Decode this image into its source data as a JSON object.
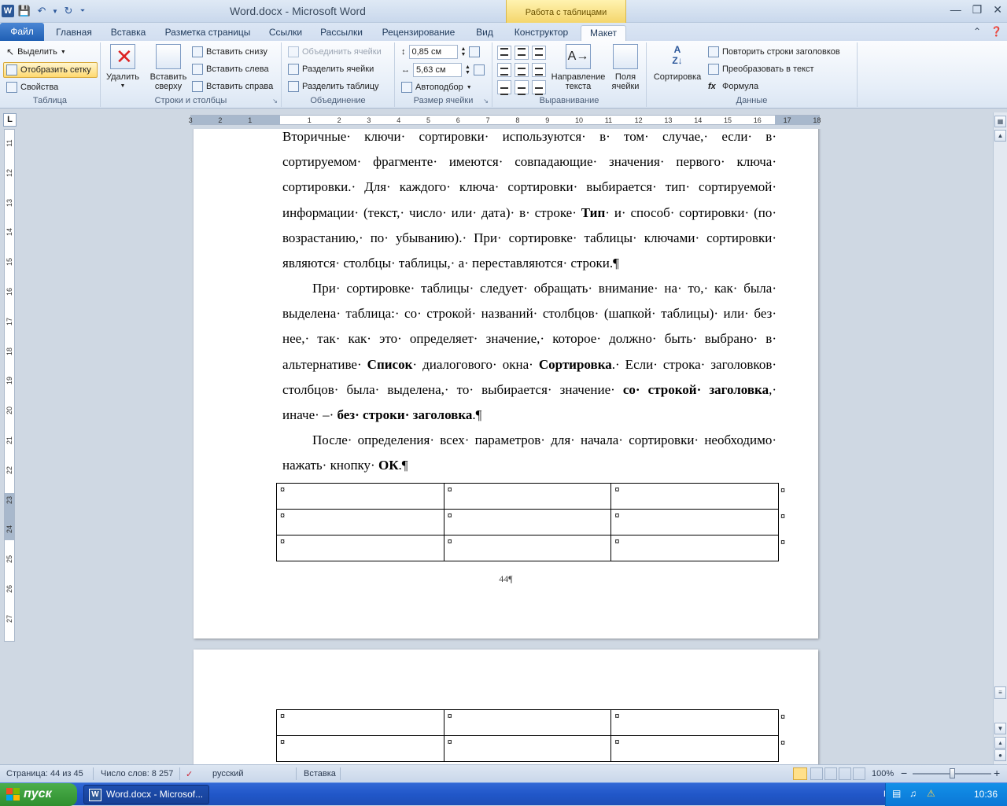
{
  "titlebar": {
    "title": "Word.docx  -  Microsoft Word",
    "context_label": "Работа с таблицами",
    "word_logo": "W"
  },
  "tabs": [
    "Файл",
    "Главная",
    "Вставка",
    "Разметка страницы",
    "Ссылки",
    "Рассылки",
    "Рецензирование",
    "Вид",
    "Конструктор",
    "Макет"
  ],
  "ribbon": {
    "table": {
      "label": "Таблица",
      "select": "Выделить",
      "show_grid": "Отобразить сетку",
      "properties": "Свойства"
    },
    "rows_cols": {
      "label": "Строки и столбцы",
      "delete": "Удалить",
      "insert_above_1": "Вставить",
      "insert_above_2": "сверху",
      "insert_below": "Вставить снизу",
      "insert_left": "Вставить слева",
      "insert_right": "Вставить справа"
    },
    "merge": {
      "label": "Объединение",
      "merge_cells": "Объединить ячейки",
      "split_cells": "Разделить ячейки",
      "split_table": "Разделить таблицу"
    },
    "cell_size": {
      "label": "Размер ячейки",
      "height": "0,85 см",
      "width": "5,63 см",
      "autofit": "Автоподбор"
    },
    "alignment": {
      "label": "Выравнивание",
      "direction_1": "Направление",
      "direction_2": "текста",
      "margins_1": "Поля",
      "margins_2": "ячейки"
    },
    "data": {
      "label": "Данные",
      "sort": "Сортировка",
      "repeat_header": "Повторить строки заголовков",
      "convert": "Преобразовать в текст",
      "formula": "Формула"
    }
  },
  "ruler": {
    "corner": "L",
    "h_ticks": [
      "3",
      "2",
      "1",
      "1",
      "2",
      "3",
      "4",
      "5",
      "6",
      "7",
      "8",
      "9",
      "10",
      "11",
      "12",
      "13",
      "14",
      "15",
      "16",
      "17",
      "18"
    ],
    "v_ticks": [
      "11",
      "12",
      "13",
      "14",
      "15",
      "16",
      "17",
      "18",
      "19",
      "20",
      "21",
      "22",
      "23",
      "24",
      "25",
      "26",
      "27"
    ]
  },
  "document": {
    "para1": [
      {
        "t": "Вторичные· ключи· сортировки· используются· в· том· случае,· если· в· сортируемом· фрагменте· имеются· совпадающие· значения· первого· ключа· сортировки.· Для· каждого· ключа· сортировки· выбирается· тип· сортируемой· информации· (текст,· число· или· дата)· в· строке· "
      },
      {
        "b": "Тип"
      },
      {
        "t": "· и· способ· сортировки· (по· возрастанию,· по· убыванию).· При· сортировке· таблицы· ключами· сортировки· являются· столбцы· таблицы,· а· переставляются· строки.¶"
      }
    ],
    "para2": [
      {
        "t": "При· сортировке· таблицы· следует· обращать· внимание· на· то,· как· была· выделена· таблица:· со· строкой· названий· столбцов· (шапкой· таблицы)· или· без· нее,· так· как· это· определяет· значение,· которое· должно· быть· выбрано· в· альтернативе· "
      },
      {
        "b": "Список"
      },
      {
        "t": "· диалогового· окна· "
      },
      {
        "b": "Сортировка"
      },
      {
        "t": ".· Если· строка· заголовков· столбцов· была· выделена,· то· выбирается· значение· "
      },
      {
        "b": "со· строкой· заголовка"
      },
      {
        "t": ",· иначе· –· "
      },
      {
        "b": "без· строки· заголовка"
      },
      {
        "t": ".¶"
      }
    ],
    "para3": [
      {
        "t": "После· определения· всех· параметров· для· начала· сортировки· необходимо· нажать· кнопку· "
      },
      {
        "b": "ОК"
      },
      {
        "t": ".¶"
      }
    ],
    "cell_mark": "¤",
    "page_number": "44¶"
  },
  "statusbar": {
    "page": "Страница: 44 из 45",
    "words": "Число слов: 8 257",
    "language": "русский",
    "mode": "Вставка",
    "zoom": "100%",
    "zoom_minus": "−",
    "zoom_plus": "+"
  },
  "taskbar": {
    "start": "пуск",
    "task": "Word.docx - Microsof...",
    "lang": "RL",
    "clock": "10:36"
  }
}
